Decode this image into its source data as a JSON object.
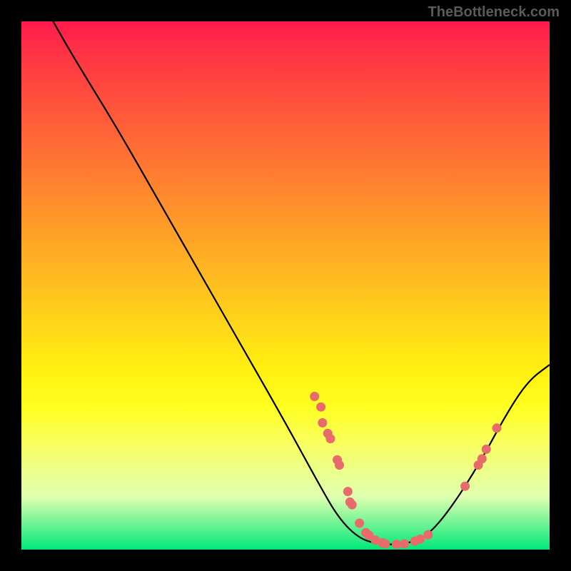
{
  "watermark": "TheBottleneck.com",
  "chart_data": {
    "type": "line",
    "title": "",
    "xlabel": "",
    "ylabel": "",
    "xlim": [
      0,
      100
    ],
    "ylim": [
      0,
      100
    ],
    "curve": [
      {
        "x": 6,
        "y": 100
      },
      {
        "x": 10,
        "y": 93
      },
      {
        "x": 18,
        "y": 80
      },
      {
        "x": 26,
        "y": 66
      },
      {
        "x": 34,
        "y": 52
      },
      {
        "x": 42,
        "y": 38
      },
      {
        "x": 50,
        "y": 24
      },
      {
        "x": 56,
        "y": 13
      },
      {
        "x": 60,
        "y": 6
      },
      {
        "x": 64,
        "y": 2
      },
      {
        "x": 68,
        "y": 1
      },
      {
        "x": 72,
        "y": 1
      },
      {
        "x": 76,
        "y": 2
      },
      {
        "x": 80,
        "y": 6
      },
      {
        "x": 86,
        "y": 15
      },
      {
        "x": 92,
        "y": 26
      },
      {
        "x": 96,
        "y": 32
      },
      {
        "x": 100,
        "y": 35
      }
    ],
    "markers": [
      {
        "x": 55.5,
        "y": 29
      },
      {
        "x": 56.7,
        "y": 27
      },
      {
        "x": 57.0,
        "y": 24
      },
      {
        "x": 58.0,
        "y": 22
      },
      {
        "x": 58.5,
        "y": 21
      },
      {
        "x": 59.8,
        "y": 17
      },
      {
        "x": 60.2,
        "y": 16
      },
      {
        "x": 61.8,
        "y": 11
      },
      {
        "x": 62.2,
        "y": 9
      },
      {
        "x": 62.6,
        "y": 8.5
      },
      {
        "x": 64.0,
        "y": 5
      },
      {
        "x": 65.2,
        "y": 3.2
      },
      {
        "x": 65.8,
        "y": 2.7
      },
      {
        "x": 67.0,
        "y": 1.8
      },
      {
        "x": 68.3,
        "y": 1.3
      },
      {
        "x": 68.9,
        "y": 1.1
      },
      {
        "x": 71.0,
        "y": 1.0
      },
      {
        "x": 72.5,
        "y": 1.1
      },
      {
        "x": 74.5,
        "y": 1.6
      },
      {
        "x": 75.5,
        "y": 2.0
      },
      {
        "x": 77.0,
        "y": 2.8
      },
      {
        "x": 84.0,
        "y": 12
      },
      {
        "x": 86.5,
        "y": 16
      },
      {
        "x": 87.2,
        "y": 17.2
      },
      {
        "x": 88.0,
        "y": 19
      },
      {
        "x": 90.0,
        "y": 23
      }
    ],
    "marker_color": "#e86a6a",
    "curve_color": "#000000"
  }
}
